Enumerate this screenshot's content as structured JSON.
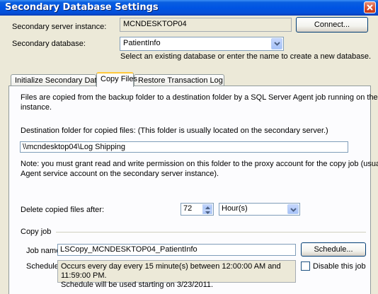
{
  "window": {
    "title": "Secondary Database Settings"
  },
  "server": {
    "label": "Secondary server instance:",
    "value": "MCNDESKTOP04",
    "connect_button": "Connect..."
  },
  "database": {
    "label": "Secondary database:",
    "value": "PatientInfo",
    "hint": "Select an existing database or enter the name to create a new database."
  },
  "tabs": [
    {
      "label": "Initialize Secondary Database",
      "active": false
    },
    {
      "label": "Copy Files",
      "active": true
    },
    {
      "label": "Restore Transaction Log",
      "active": false
    }
  ],
  "copy_files": {
    "intro_line1": "Files are copied from the backup folder to a destination folder by a SQL Server Agent job running on the secondary server",
    "intro_line2": "instance.",
    "dest_label": "Destination folder for copied files: (This folder is usually located on the secondary server.)",
    "dest_value": "\\\\mcndesktop04\\Log Shipping",
    "note_line1": "Note: you must grant read and write permission on this folder to the proxy account for the copy job (usually the SQL Server",
    "note_line2": "Agent service account on the secondary server instance).",
    "delete_label": "Delete copied files after:",
    "delete_value": "72",
    "delete_unit": "Hour(s)",
    "group_label": "Copy job",
    "job_name_label": "Job name:",
    "job_name_value": "LSCopy_MCNDESKTOP04_PatientInfo",
    "schedule_button": "Schedule...",
    "schedule_label": "Schedule:",
    "schedule_line1": "Occurs every day every 15 minute(s) between 12:00:00 AM and 11:59:00 PM.",
    "schedule_line2": "Schedule will be used starting on 3/23/2011.",
    "disable_label": "Disable this job",
    "disable_checked": false
  },
  "colors": {
    "titlebar": "#0054e3",
    "active_tab_accent": "#ffc83c",
    "dialog_bg": "#ece9d8"
  }
}
